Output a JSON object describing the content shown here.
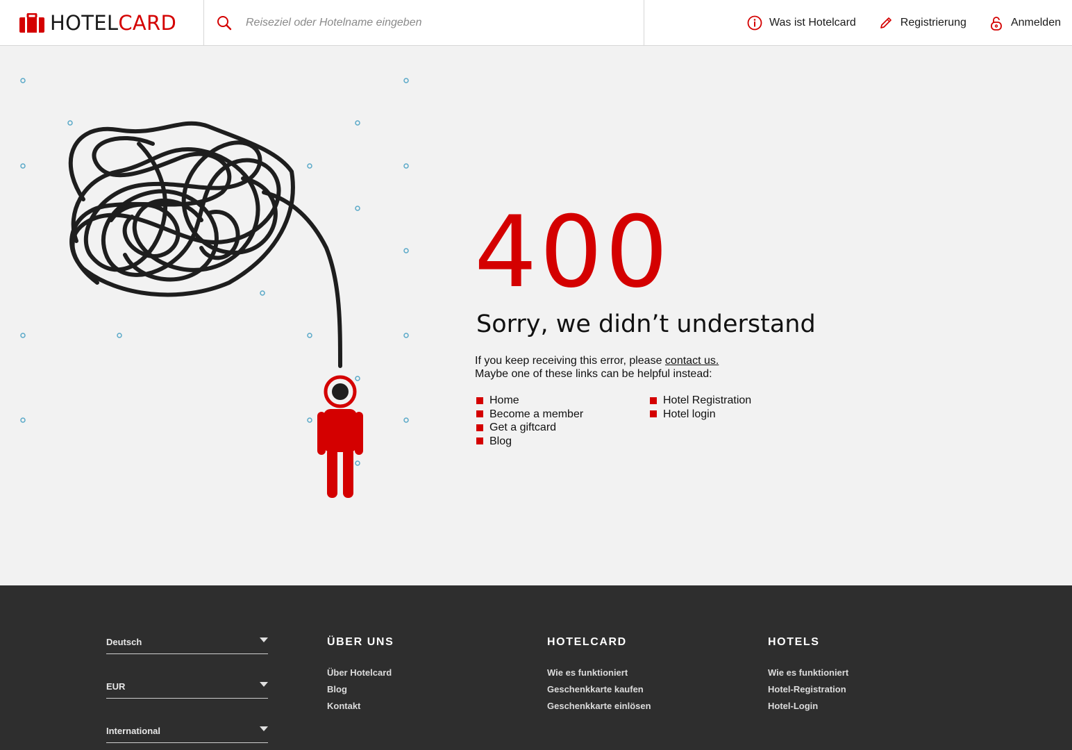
{
  "header": {
    "logo": {
      "part1": "HOTEL",
      "part2": "CARD"
    },
    "search": {
      "placeholder": "Reiseziel oder Hotelname eingeben",
      "value": ""
    },
    "nav": [
      {
        "label": "Was ist Hotelcard",
        "icon": "info-icon"
      },
      {
        "label": "Registrierung",
        "icon": "pencil-icon"
      },
      {
        "label": "Anmelden",
        "icon": "lock-icon"
      }
    ]
  },
  "error": {
    "code": "400",
    "title": "Sorry, we didn’t understand",
    "line1_prefix": "If you keep receiving this error, please ",
    "contact_link": "contact us.",
    "line2": "Maybe one of these links can be helpful instead:",
    "links_col1": [
      "Home",
      "Become a member",
      "Get a giftcard",
      "Blog"
    ],
    "links_col2": [
      "Hotel Registration",
      "Hotel login"
    ]
  },
  "footer": {
    "selects": {
      "language": "Deutsch",
      "currency": "EUR",
      "region": "International"
    },
    "columns": [
      {
        "title": "ÜBER UNS",
        "links": [
          "Über Hotelcard",
          "Blog",
          "Kontakt"
        ]
      },
      {
        "title": "HOTELCARD",
        "links": [
          "Wie es funktioniert",
          "Geschenkkarte kaufen",
          "Geschenkkarte einlösen"
        ]
      },
      {
        "title": "HOTELS",
        "links": [
          "Wie es funktioniert",
          "Hotel-Registration",
          "Hotel-Login"
        ]
      }
    ]
  },
  "colors": {
    "brand_red": "#d40000",
    "footer_bg": "#2e2e2e",
    "page_bg": "#f2f2f2"
  }
}
